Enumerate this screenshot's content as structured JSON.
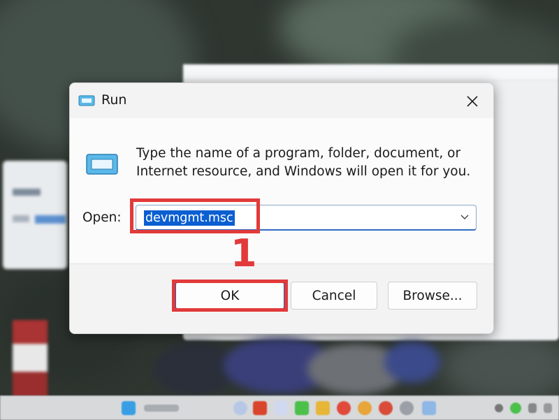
{
  "dialog": {
    "title": "Run",
    "description": "Type the name of a program, folder, document, or Internet resource, and Windows will open it for you.",
    "open_label": "Open:",
    "open_value": "devmgmt.msc",
    "buttons": {
      "ok": "OK",
      "cancel": "Cancel",
      "browse": "Browse..."
    },
    "icons": {
      "title": "run-icon",
      "close": "close-icon",
      "large": "run-icon",
      "dropdown": "chevron-down-icon"
    }
  },
  "annotation": {
    "step_number": "1",
    "highlight_color": "#e23a3a"
  },
  "colors": {
    "accent": "#0b5fd1",
    "selection_text": "#ffffff"
  },
  "taskbar": {
    "icons": [
      "start-icon",
      "search-icon",
      "widget-icon",
      "office-icon",
      "chat-icon",
      "folder-icon",
      "chrome-icon",
      "chrome-icon",
      "chrome-icon",
      "settings-icon",
      "app-icon",
      "tray-icon",
      "tray-icon",
      "tray-icon",
      "tray-icon"
    ]
  }
}
